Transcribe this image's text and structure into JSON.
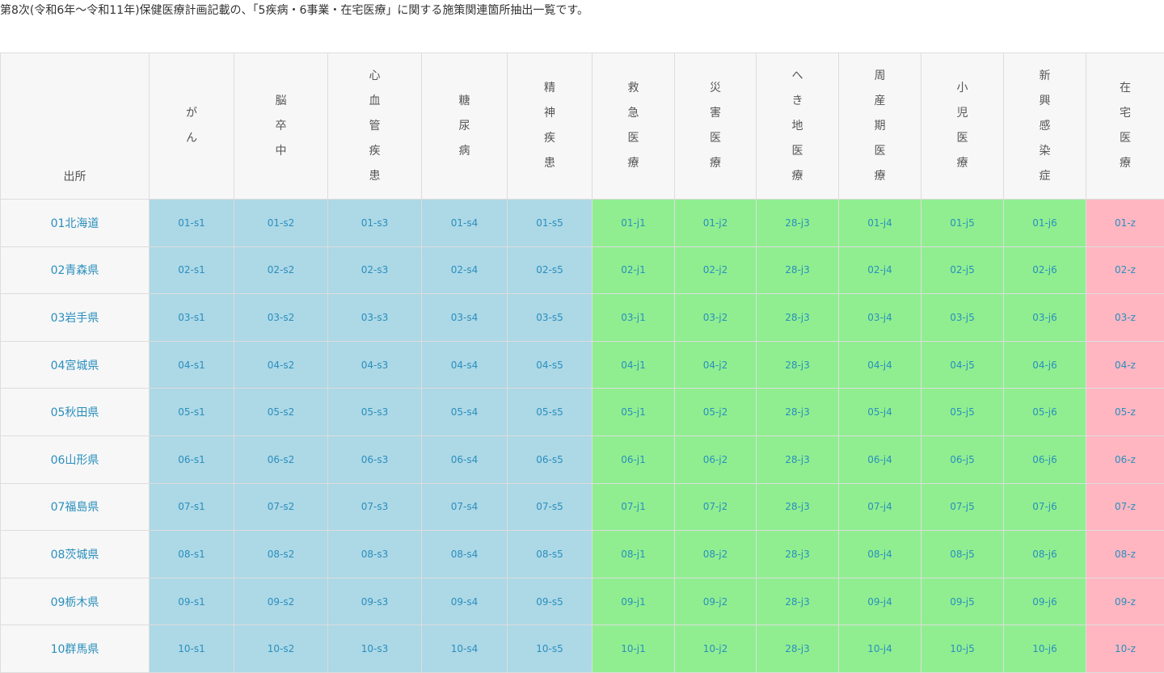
{
  "intro_text": "第8次(令和6年～令和11年)保健医療計画記載の、「5疾病・6事業・在宅医療」に関する施策関連箇所抽出一覧です。",
  "colors": {
    "disease": "#add8e6",
    "project": "#90ee90",
    "home": "#ffb6c1",
    "link": "#2a8fbd",
    "header_bg": "#f7f7f7"
  },
  "table": {
    "corner_label": "出所",
    "columns": [
      {
        "label": "がん",
        "group": "s"
      },
      {
        "label": "脳卒中",
        "group": "s"
      },
      {
        "label": "心血管疾患",
        "group": "s"
      },
      {
        "label": "糖尿病",
        "group": "s"
      },
      {
        "label": "精神疾患",
        "group": "s"
      },
      {
        "label": "救急医療",
        "group": "j"
      },
      {
        "label": "災害医療",
        "group": "j"
      },
      {
        "label": "へき地医療",
        "group": "j"
      },
      {
        "label": "周産期医療",
        "group": "j"
      },
      {
        "label": "小児医療",
        "group": "j"
      },
      {
        "label": "新興感染症",
        "group": "j"
      },
      {
        "label": "在宅医療",
        "group": "z"
      }
    ],
    "rows": [
      {
        "pref": "01北海道",
        "cells": [
          "01-s1",
          "01-s2",
          "01-s3",
          "01-s4",
          "01-s5",
          "01-j1",
          "01-j2",
          "28-j3",
          "01-j4",
          "01-j5",
          "01-j6",
          "01-z"
        ]
      },
      {
        "pref": "02青森県",
        "cells": [
          "02-s1",
          "02-s2",
          "02-s3",
          "02-s4",
          "02-s5",
          "02-j1",
          "02-j2",
          "28-j3",
          "02-j4",
          "02-j5",
          "02-j6",
          "02-z"
        ]
      },
      {
        "pref": "03岩手県",
        "cells": [
          "03-s1",
          "03-s2",
          "03-s3",
          "03-s4",
          "03-s5",
          "03-j1",
          "03-j2",
          "28-j3",
          "03-j4",
          "03-j5",
          "03-j6",
          "03-z"
        ]
      },
      {
        "pref": "04宮城県",
        "cells": [
          "04-s1",
          "04-s2",
          "04-s3",
          "04-s4",
          "04-s5",
          "04-j1",
          "04-j2",
          "28-j3",
          "04-j4",
          "04-j5",
          "04-j6",
          "04-z"
        ]
      },
      {
        "pref": "05秋田県",
        "cells": [
          "05-s1",
          "05-s2",
          "05-s3",
          "05-s4",
          "05-s5",
          "05-j1",
          "05-j2",
          "28-j3",
          "05-j4",
          "05-j5",
          "05-j6",
          "05-z"
        ]
      },
      {
        "pref": "06山形県",
        "cells": [
          "06-s1",
          "06-s2",
          "06-s3",
          "06-s4",
          "06-s5",
          "06-j1",
          "06-j2",
          "28-j3",
          "06-j4",
          "06-j5",
          "06-j6",
          "06-z"
        ]
      },
      {
        "pref": "07福島県",
        "cells": [
          "07-s1",
          "07-s2",
          "07-s3",
          "07-s4",
          "07-s5",
          "07-j1",
          "07-j2",
          "28-j3",
          "07-j4",
          "07-j5",
          "07-j6",
          "07-z"
        ]
      },
      {
        "pref": "08茨城県",
        "cells": [
          "08-s1",
          "08-s2",
          "08-s3",
          "08-s4",
          "08-s5",
          "08-j1",
          "08-j2",
          "28-j3",
          "08-j4",
          "08-j5",
          "08-j6",
          "08-z"
        ]
      },
      {
        "pref": "09栃木県",
        "cells": [
          "09-s1",
          "09-s2",
          "09-s3",
          "09-s4",
          "09-s5",
          "09-j1",
          "09-j2",
          "28-j3",
          "09-j4",
          "09-j5",
          "09-j6",
          "09-z"
        ]
      },
      {
        "pref": "10群馬県",
        "cells": [
          "10-s1",
          "10-s2",
          "10-s3",
          "10-s4",
          "10-s5",
          "10-j1",
          "10-j2",
          "28-j3",
          "10-j4",
          "10-j5",
          "10-j6",
          "10-z"
        ]
      }
    ]
  }
}
